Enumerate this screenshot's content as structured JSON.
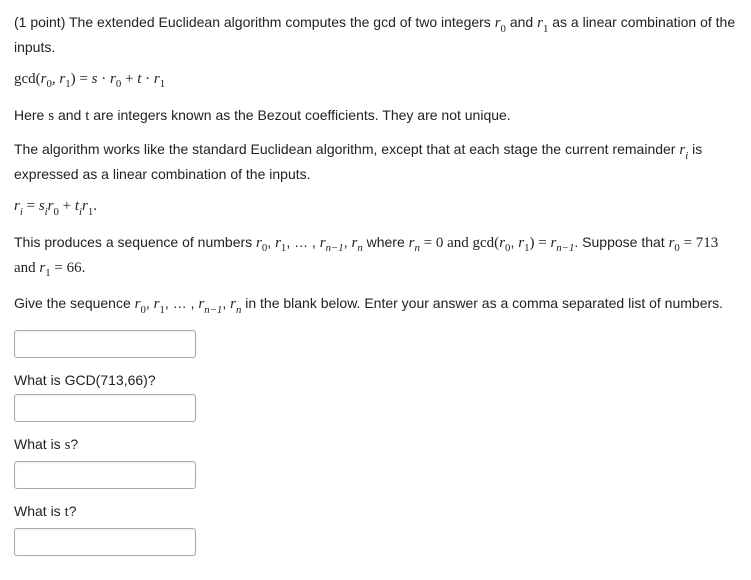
{
  "points": "(1 point)",
  "intro1": " The extended Euclidean algorithm computes the gcd of two integers ",
  "intro2": " and ",
  "intro3": " as a linear combination of the inputs.",
  "eq1_pre": "gcd(",
  "eq1_comma": ", ",
  "eq1_close": ") = ",
  "eq1_s": "s",
  "eq1_dot1": " · ",
  "eq1_plus": " + ",
  "eq1_t": "t",
  "eq1_dot2": " · ",
  "here1": "Here ",
  "here2": " and ",
  "here3": " are integers known as the Bezout coefficients. They are not unique.",
  "alg1": "The algorithm works like the standard Euclidean algorithm, except that at each stage the current remainder ",
  "alg2": " is expressed as a linear combination of the inputs.",
  "eq2_eq": " = ",
  "eq2_plus": " + ",
  "eq2_dot": ".",
  "r": "r",
  "s": "s",
  "t": "t",
  "sub0": "0",
  "sub1": "1",
  "subi": "i",
  "subn": "n",
  "subnm1": "n−1",
  "seq1": "This produces a sequence of numbers ",
  "seq2": ", ",
  "seq3": ", … , ",
  "seq4": ", ",
  "seq5": " where ",
  "seq6": " = 0 and gcd(",
  "seq7": ", ",
  "seq8": ") = ",
  "seq9": ". Suppose that ",
  "seq10": " = 713 and ",
  "seq11": " = 66.",
  "give1": "Give the sequence ",
  "give2": ", ",
  "give3": ", … , ",
  "give4": ", ",
  "give5": " in the blank below. Enter your answer as a comma separated list of numbers.",
  "q_gcd": "What is GCD(713,66)?",
  "q_s1": "What is ",
  "q_s2": "?",
  "q_t1": "What is ",
  "q_t2": "?",
  "chart_data": {
    "type": "table",
    "given": {
      "r0": 713,
      "r1": 66
    },
    "questions": [
      "sequence r_0..r_n",
      "GCD(713,66)",
      "s",
      "t"
    ]
  }
}
